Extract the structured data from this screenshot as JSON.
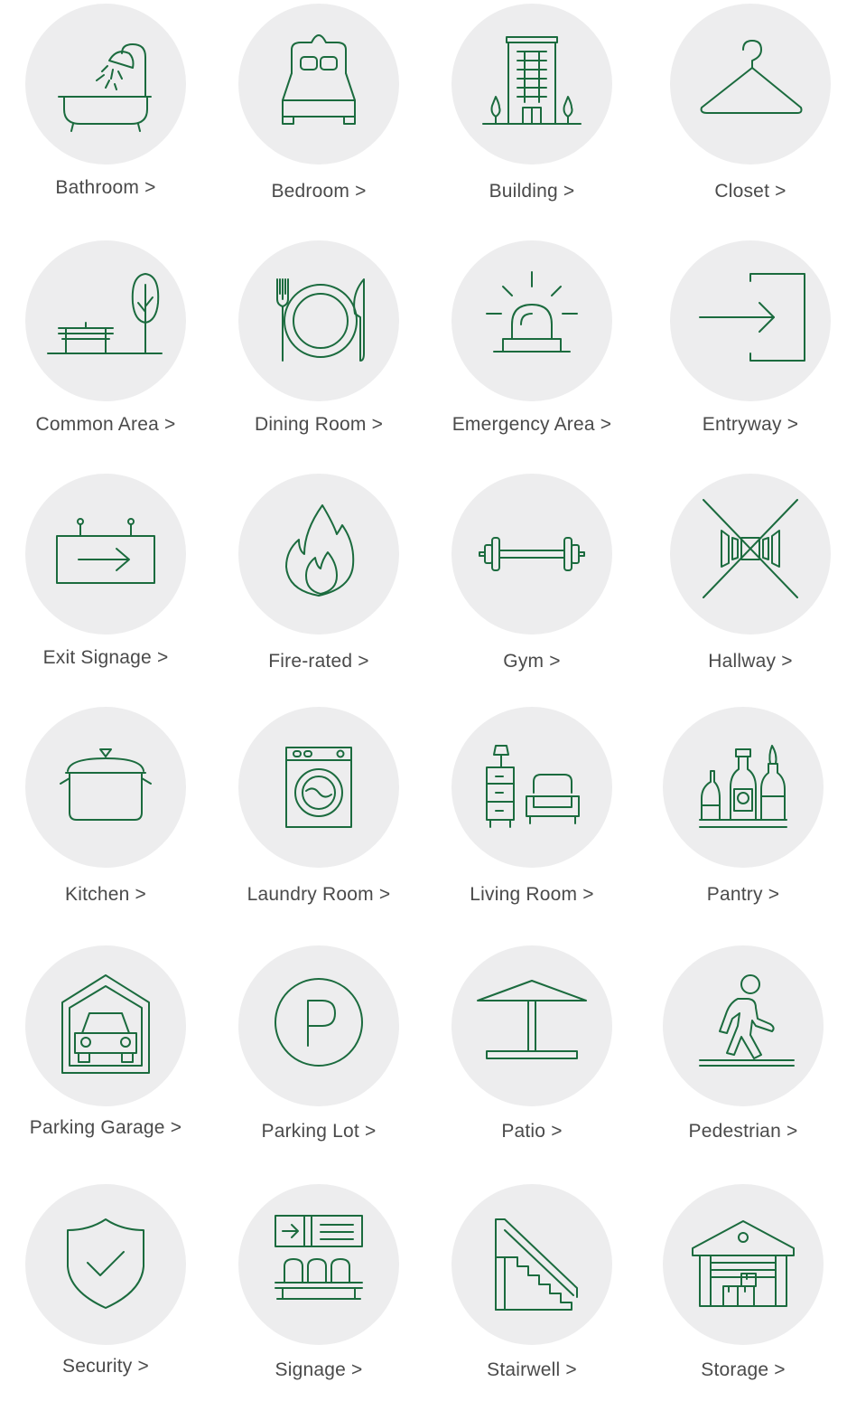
{
  "tiles": [
    {
      "label": "Bathroom >",
      "icon": "bathtub-shower-icon"
    },
    {
      "label": "Bedroom >",
      "icon": "bed-icon"
    },
    {
      "label": "Building >",
      "icon": "building-icon"
    },
    {
      "label": "Closet >",
      "icon": "hanger-icon"
    },
    {
      "label": "Common Area >",
      "icon": "park-bench-tree-icon"
    },
    {
      "label": "Dining Room >",
      "icon": "plate-fork-knife-icon"
    },
    {
      "label": "Emergency Area >",
      "icon": "siren-icon"
    },
    {
      "label": "Entryway >",
      "icon": "enter-door-icon"
    },
    {
      "label": "Exit Signage >",
      "icon": "hanging-arrow-sign-icon"
    },
    {
      "label": "Fire-rated >",
      "icon": "flame-icon"
    },
    {
      "label": "Gym >",
      "icon": "dumbbell-icon"
    },
    {
      "label": "Hallway >",
      "icon": "hallway-perspective-icon"
    },
    {
      "label": "Kitchen >",
      "icon": "cooking-pot-icon"
    },
    {
      "label": "Laundry Room >",
      "icon": "washing-machine-icon"
    },
    {
      "label": "Living Room >",
      "icon": "lamp-armchair-icon"
    },
    {
      "label": "Pantry >",
      "icon": "bottles-shelf-icon"
    },
    {
      "label": "Parking Garage >",
      "icon": "garage-car-icon"
    },
    {
      "label": "Parking Lot >",
      "icon": "parking-p-icon"
    },
    {
      "label": "Patio >",
      "icon": "patio-umbrella-icon"
    },
    {
      "label": "Pedestrian >",
      "icon": "walking-person-icon"
    },
    {
      "label": "Security >",
      "icon": "shield-check-icon"
    },
    {
      "label": "Signage >",
      "icon": "waiting-area-sign-icon"
    },
    {
      "label": "Stairwell >",
      "icon": "staircase-icon"
    },
    {
      "label": "Storage >",
      "icon": "warehouse-boxes-icon"
    }
  ],
  "colors": {
    "icon_stroke": "#1b6b3e",
    "circle_fill": "#ededee",
    "label_text": "#4a4a4a"
  }
}
